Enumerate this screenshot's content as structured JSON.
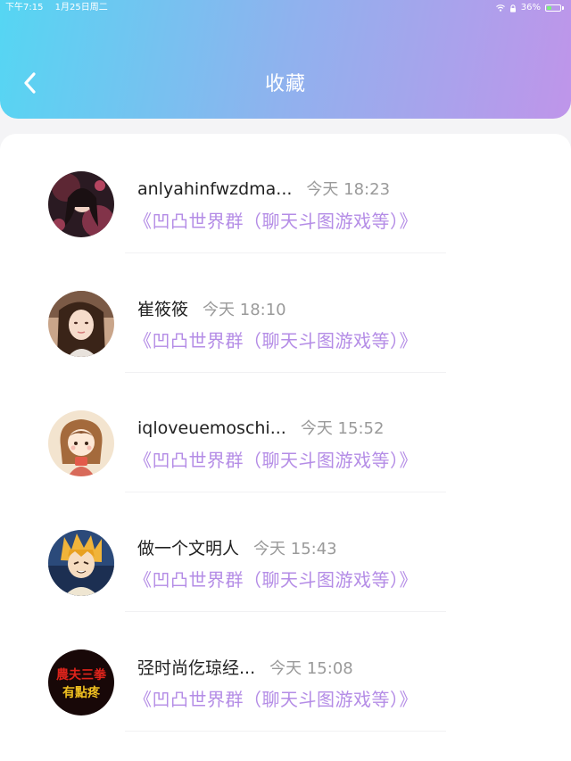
{
  "status_bar": {
    "time": "下午7:15",
    "date": "1月25日周二",
    "battery": "36%",
    "battery_level": 0.36,
    "icons": [
      "wifi-icon",
      "lock-icon",
      "battery-icon"
    ]
  },
  "header": {
    "title": "收藏",
    "back_icon": "chevron-left-icon",
    "gradient": [
      "#55d6f3",
      "#8fb2ee",
      "#bf95ea"
    ]
  },
  "colors": {
    "accent": "#b48ce6",
    "name": "#222222",
    "time": "#9a9a9a"
  },
  "favorites": [
    {
      "name": "anlyahinfwzdma...",
      "time": "今天 18:23",
      "group": "《凹凸世界群（聊天斗图游戏等）》",
      "avatar": "anime-girl-dark-avatar"
    },
    {
      "name": "崔筱筱",
      "time": "今天 18:10",
      "group": "《凹凸世界群（聊天斗图游戏等）》",
      "avatar": "photo-girl-avatar"
    },
    {
      "name": "iqloveuemoschi...",
      "time": "今天 15:52",
      "group": "《凹凸世界群（聊天斗图游戏等）》",
      "avatar": "cartoon-girl-avatar"
    },
    {
      "name": "做一个文明人",
      "time": "今天 15:43",
      "group": "《凹凸世界群（聊天斗图游戏等）》",
      "avatar": "anime-boy-avatar"
    },
    {
      "name": "弪时尚仡琼经...",
      "time": "今天 15:08",
      "group": "《凹凸世界群（聊天斗图游戏等）》",
      "avatar": "text-sticker-avatar",
      "avatar_text": [
        "農夫三拳",
        "有點疼"
      ]
    }
  ]
}
